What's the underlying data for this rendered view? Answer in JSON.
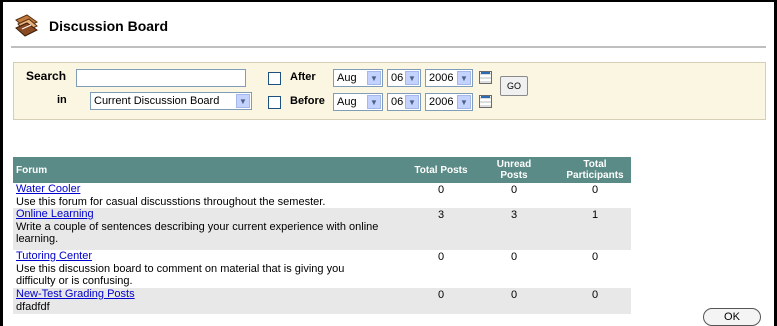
{
  "page": {
    "title": "Discussion Board"
  },
  "search": {
    "label": "Search",
    "query_value": "",
    "in_label": "in",
    "scope_value": "Current Discussion Board",
    "after": {
      "label": "After",
      "checked": false,
      "month": "Aug",
      "day": "06",
      "year": "2006"
    },
    "before": {
      "label": "Before",
      "checked": false,
      "month": "Aug",
      "day": "06",
      "year": "2006"
    },
    "go_label": "GO"
  },
  "table": {
    "headers": {
      "forum": "Forum",
      "total_posts": "Total Posts",
      "unread_posts": [
        "Unread",
        "Posts"
      ],
      "total_participants": [
        "Total",
        "Participants"
      ]
    },
    "rows": [
      {
        "name": "Water Cooler",
        "description": [
          "Use this forum for casual discusstions throughout the semester."
        ],
        "total_posts": "0",
        "unread_posts": "0",
        "participants": "0"
      },
      {
        "name": "Online Learning",
        "description": [
          "Write a couple of sentences describing your current experience with online",
          "learning."
        ],
        "total_posts": "3",
        "unread_posts": "3",
        "participants": "1"
      },
      {
        "name": "Tutoring Center",
        "description": [
          "Use this discussion board to comment on material that is giving you",
          "difficulty or is confusing."
        ],
        "total_posts": "0",
        "unread_posts": "0",
        "participants": "0"
      },
      {
        "name": "New-Test Grading Posts",
        "description": [
          "dfadfdf"
        ],
        "total_posts": "0",
        "unread_posts": "0",
        "participants": "0"
      }
    ]
  },
  "footer": {
    "ok_label": "OK"
  },
  "colors": {
    "header_bg": "#5b8b86",
    "search_bg": "#fbf6e2",
    "link": "#0000cc",
    "alt_row": "#e8e8e8"
  }
}
